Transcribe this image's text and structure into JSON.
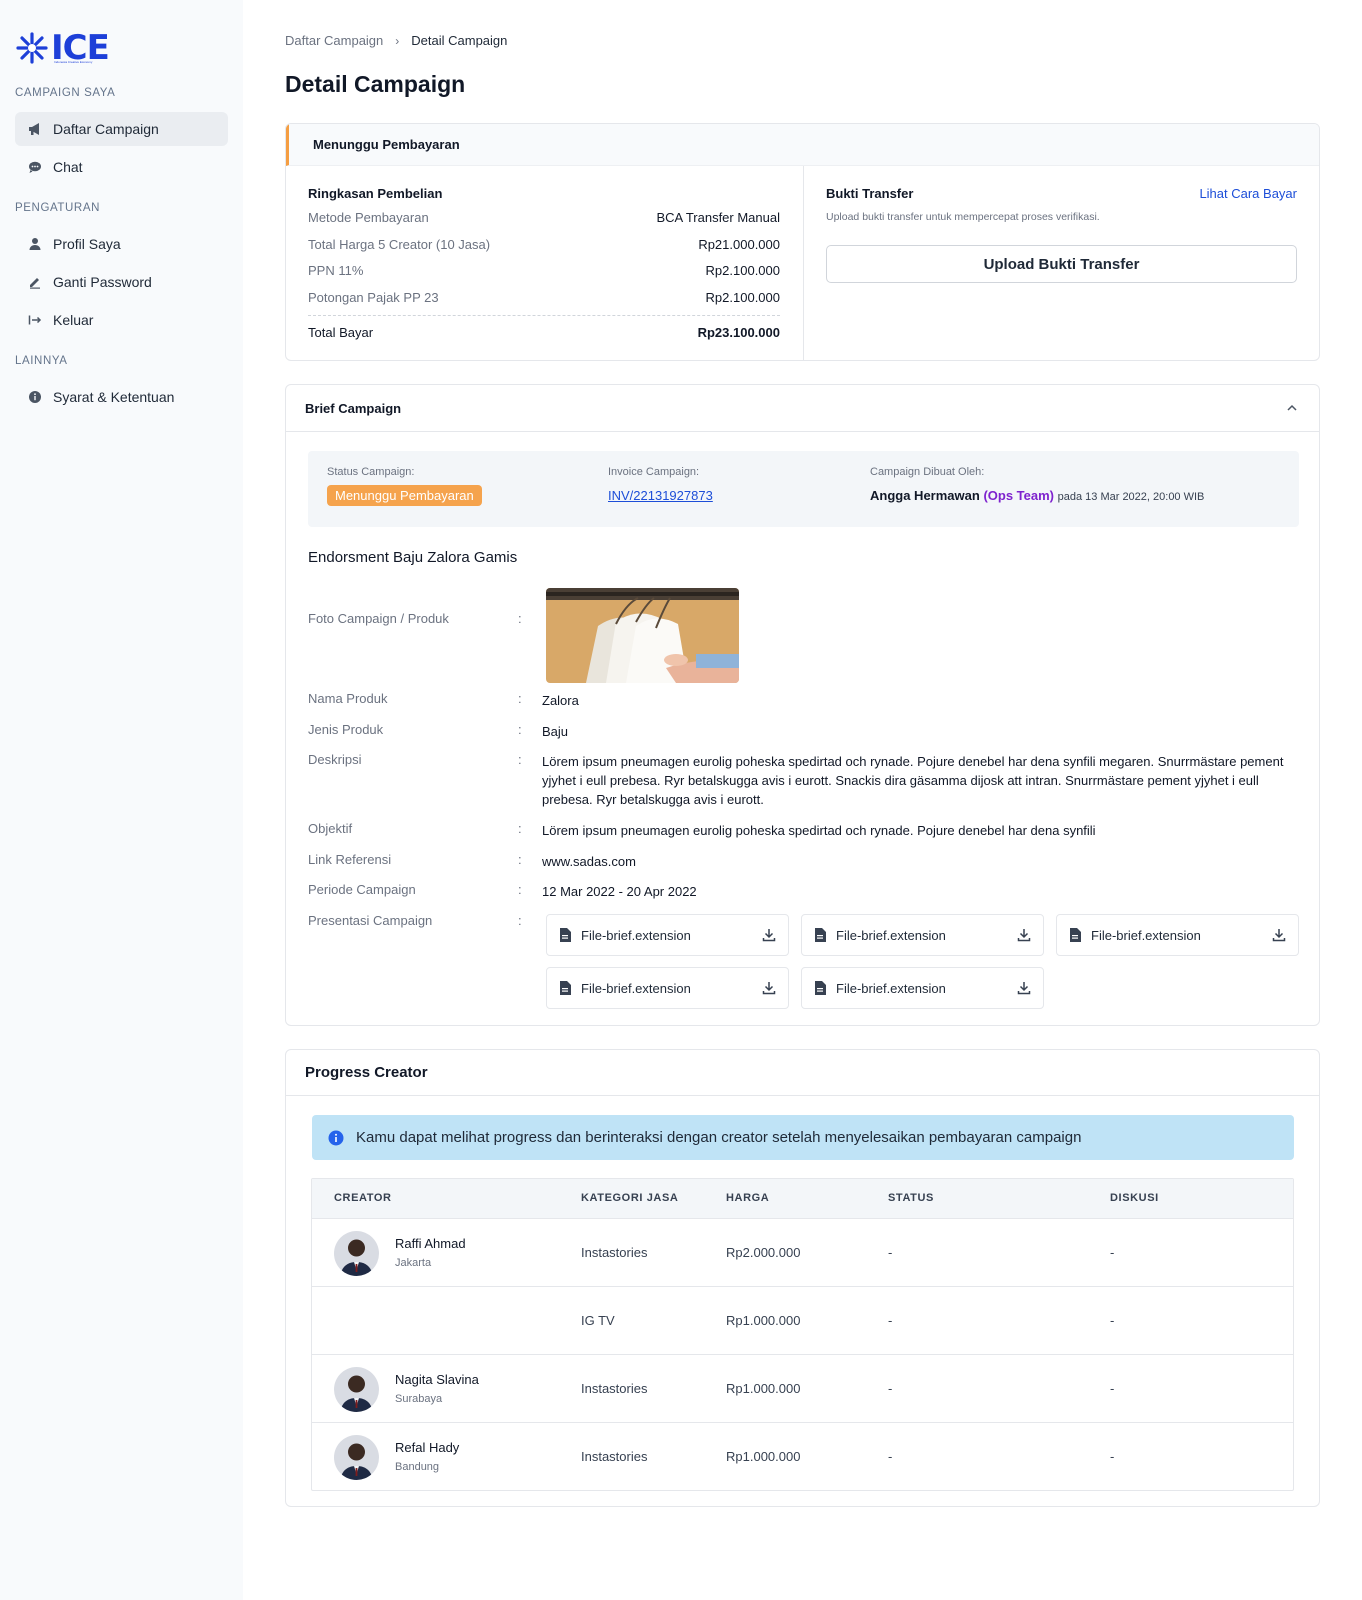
{
  "brand": {
    "name": "ICE",
    "tagline": "Indonesia Creative Economy",
    "color": "#1d3fd8"
  },
  "sidebar": {
    "sections": [
      {
        "title": "CAMPAIGN SAYA",
        "items": [
          {
            "label": "Daftar Campaign",
            "icon": "megaphone-icon",
            "active": true
          },
          {
            "label": "Chat",
            "icon": "chat-icon"
          }
        ]
      },
      {
        "title": "PENGATURAN",
        "items": [
          {
            "label": "Profil Saya",
            "icon": "user-icon"
          },
          {
            "label": "Ganti Password",
            "icon": "pencil-icon"
          },
          {
            "label": "Keluar",
            "icon": "logout-icon"
          }
        ]
      },
      {
        "title": "LAINNYA",
        "items": [
          {
            "label": "Syarat & Ketentuan",
            "icon": "info-icon"
          }
        ]
      }
    ]
  },
  "breadcrumb": {
    "parent": "Daftar Campaign",
    "separator": "›",
    "current": "Detail Campaign"
  },
  "page_title": "Detail Campaign",
  "payment": {
    "status_title": "Menunggu Pembayaran",
    "summary": {
      "title": "Ringkasan Pembelian",
      "rows": [
        {
          "label": "Metode Pembayaran",
          "value": "BCA Transfer Manual"
        },
        {
          "label": "Total Harga 5 Creator (10 Jasa)",
          "value": "Rp21.000.000"
        },
        {
          "label": "PPN 11%",
          "value": "Rp2.100.000"
        },
        {
          "label": "Potongan Pajak PP 23",
          "value": "Rp2.100.000"
        }
      ],
      "total_label": "Total Bayar",
      "total_value": "Rp23.100.000"
    },
    "transfer": {
      "title": "Bukti Transfer",
      "link": "Lihat Cara Bayar",
      "hint": "Upload bukti transfer untuk mempercepat proses verifikasi.",
      "button": "Upload Bukti Transfer"
    }
  },
  "brief": {
    "title": "Brief Campaign",
    "status_label": "Status Campaign:",
    "status_value": "Menunggu Pembayaran",
    "invoice_label": "Invoice Campaign:",
    "invoice_value": "INV/22131927873",
    "created_label": "Campaign Dibuat Oleh:",
    "created_name": "Angga Hermawan",
    "created_team": "(Ops Team)",
    "created_date": "pada 13 Mar 2022, 20:00 WIB",
    "campaign_name": "Endorsment Baju Zalora Gamis",
    "colon": ":",
    "fields": {
      "foto": {
        "label": "Foto Campaign / Produk"
      },
      "nama": {
        "label": "Nama Produk",
        "value": "Zalora"
      },
      "jenis": {
        "label": "Jenis Produk",
        "value": "Baju"
      },
      "deskripsi": {
        "label": "Deskripsi",
        "value": "Lörem ipsum pneumagen eurolig poheska spedirtad och rynade. Pojure denebel har dena synfili megaren. Snurrmästare pement yjyhet i eull prebesa. Ryr betalskugga avis i eurott. Snackis dira gäsamma dijosk att intran. Snurrmästare pement yjyhet i eull prebesa. Ryr betalskugga avis i eurott."
      },
      "objektif": {
        "label": "Objektif",
        "value": "Lörem ipsum pneumagen eurolig poheska spedirtad och rynade. Pojure denebel har dena synfili"
      },
      "link": {
        "label": "Link Referensi",
        "value": "www.sadas.com"
      },
      "periode": {
        "label": "Periode Campaign",
        "value": "12 Mar 2022 - 20 Apr 2022"
      },
      "presentasi": {
        "label": "Presentasi Campaign"
      }
    },
    "files": [
      "File-brief.extension",
      "File-brief.extension",
      "File-brief.extension",
      "File-brief.extension",
      "File-brief.extension"
    ]
  },
  "progress": {
    "title": "Progress Creator",
    "info": "Kamu dapat melihat progress dan berinteraksi dengan creator setelah menyelesaikan pembayaran campaign",
    "columns": [
      "CREATOR",
      "KATEGORI JASA",
      "HARGA",
      "STATUS",
      "DISKUSI"
    ],
    "rows": [
      {
        "name": "Raffi Ahmad",
        "city": "Jakarta",
        "kategori": "Instastories",
        "harga": "Rp2.000.000",
        "status": "-",
        "diskusi": "-"
      },
      {
        "name": "",
        "city": "",
        "kategori": "IG TV",
        "harga": "Rp1.000.000",
        "status": "-",
        "diskusi": "-"
      },
      {
        "name": "Nagita Slavina",
        "city": "Surabaya",
        "kategori": "Instastories",
        "harga": "Rp1.000.000",
        "status": "-",
        "diskusi": "-"
      },
      {
        "name": "Refal Hady",
        "city": "Bandung",
        "kategori": "Instastories",
        "harga": "Rp1.000.000",
        "status": "-",
        "diskusi": "-"
      }
    ]
  }
}
